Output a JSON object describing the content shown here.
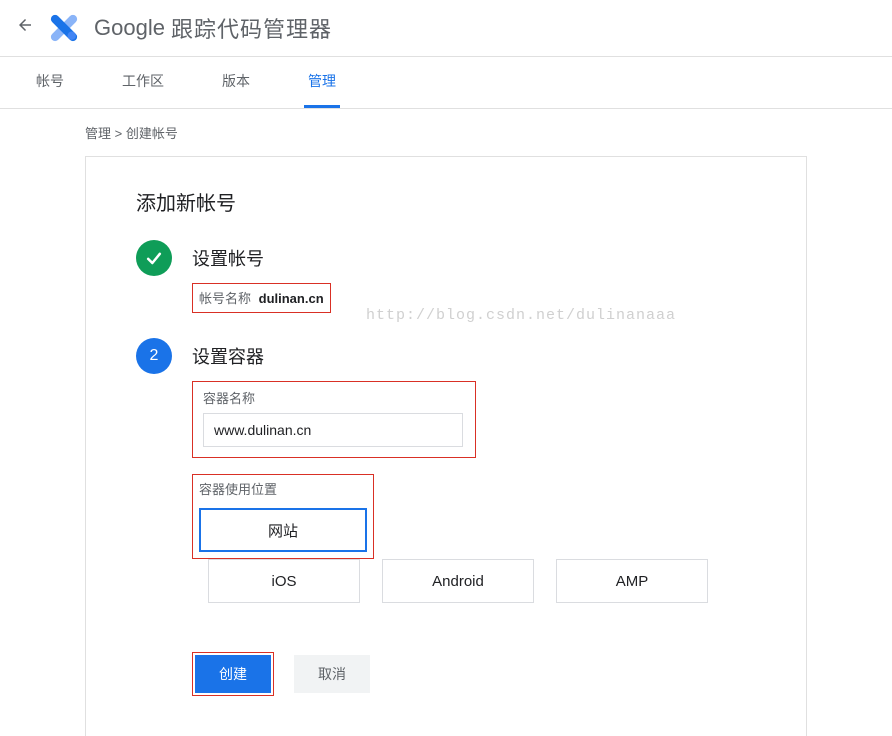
{
  "header": {
    "brand_google": "Google",
    "brand_sub": "跟踪代码管理器"
  },
  "tabs": [
    {
      "label": "帐号",
      "active": false
    },
    {
      "label": "工作区",
      "active": false
    },
    {
      "label": "版本",
      "active": false
    },
    {
      "label": "管理",
      "active": true
    }
  ],
  "breadcrumb": "管理 > 创建帐号",
  "card": {
    "title": "添加新帐号",
    "step1": {
      "title": "设置帐号",
      "summary_label": "帐号名称",
      "summary_value": "dulinan.cn"
    },
    "step2": {
      "number": "2",
      "title": "设置容器",
      "field_label": "容器名称",
      "field_value": "www.dulinan.cn",
      "usage_label": "容器使用位置",
      "platforms": [
        {
          "label": "网站",
          "selected": true
        },
        {
          "label": "iOS",
          "selected": false
        },
        {
          "label": "Android",
          "selected": false
        },
        {
          "label": "AMP",
          "selected": false
        }
      ]
    },
    "actions": {
      "create": "创建",
      "cancel": "取消"
    }
  },
  "watermark": "http://blog.csdn.net/dulinanaaa"
}
